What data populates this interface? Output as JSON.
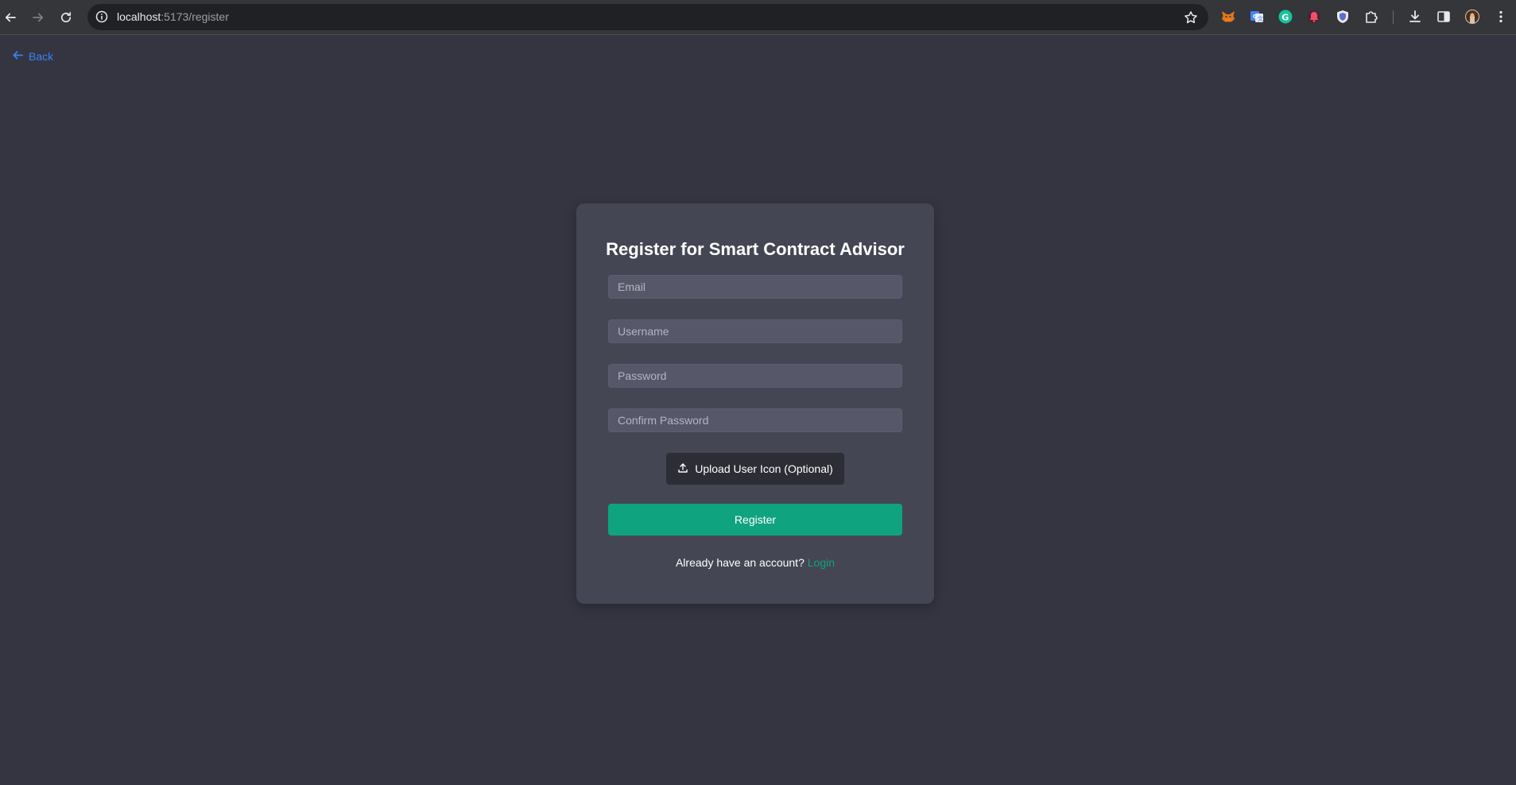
{
  "browser": {
    "url_host": "localhost",
    "url_path": ":5173/register",
    "extensions": [
      "metamask-icon",
      "google-translate-icon",
      "grammarly-icon",
      "bell-extension-icon",
      "shield-extension-icon",
      "puzzle-icon"
    ]
  },
  "page": {
    "back_label": "Back",
    "title": "Register for Smart Contract Advisor",
    "fields": {
      "email_placeholder": "Email",
      "username_placeholder": "Username",
      "password_placeholder": "Password",
      "confirm_password_placeholder": "Confirm Password"
    },
    "upload_label": "Upload User Icon (Optional)",
    "register_label": "Register",
    "login_prompt": "Already have an account?",
    "login_link": "Login"
  },
  "colors": {
    "background": "#343541",
    "card": "#444654",
    "input": "#565869",
    "accent": "#10a37f",
    "link": "#3b82f6",
    "upload_button": "#2c2d35"
  }
}
